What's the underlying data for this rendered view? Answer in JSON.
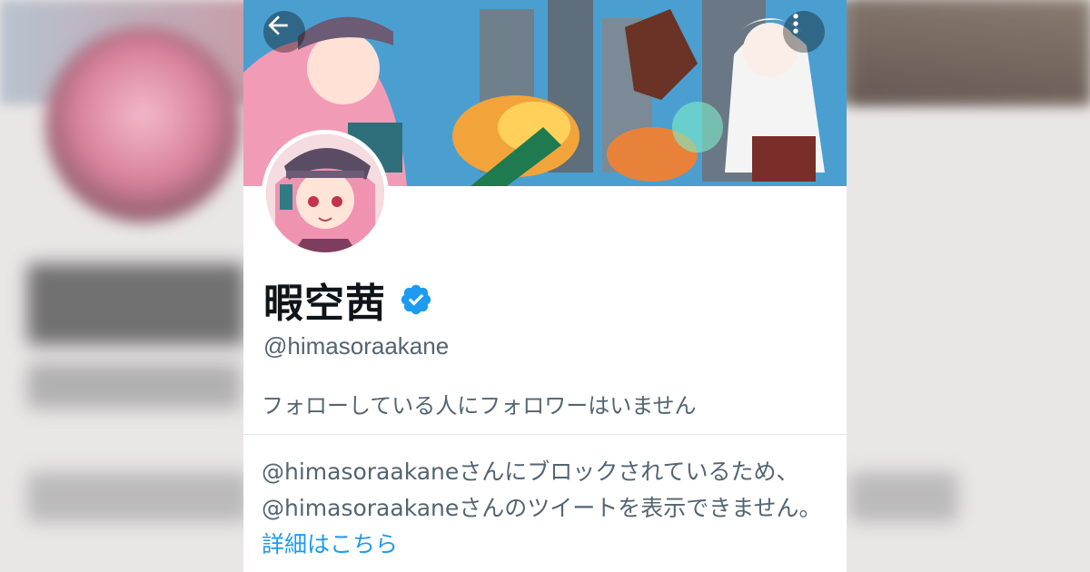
{
  "profile": {
    "display_name": "暇空茜",
    "handle": "@himasoraakane",
    "verified": true,
    "follow_info": "フォローしている人にフォロワーはいません"
  },
  "blocked_notice": {
    "text": "@himasoraakaneさんにブロックされているため、@himasoraakaneさんのツイートを表示できません。",
    "link_label": "詳細はこちら"
  },
  "icons": {
    "back": "arrow-left-icon",
    "more": "more-vertical-icon",
    "verified": "verified-badge-icon"
  },
  "colors": {
    "accent": "#1d9bf0",
    "text_primary": "#0f1419",
    "text_secondary": "#536471"
  }
}
